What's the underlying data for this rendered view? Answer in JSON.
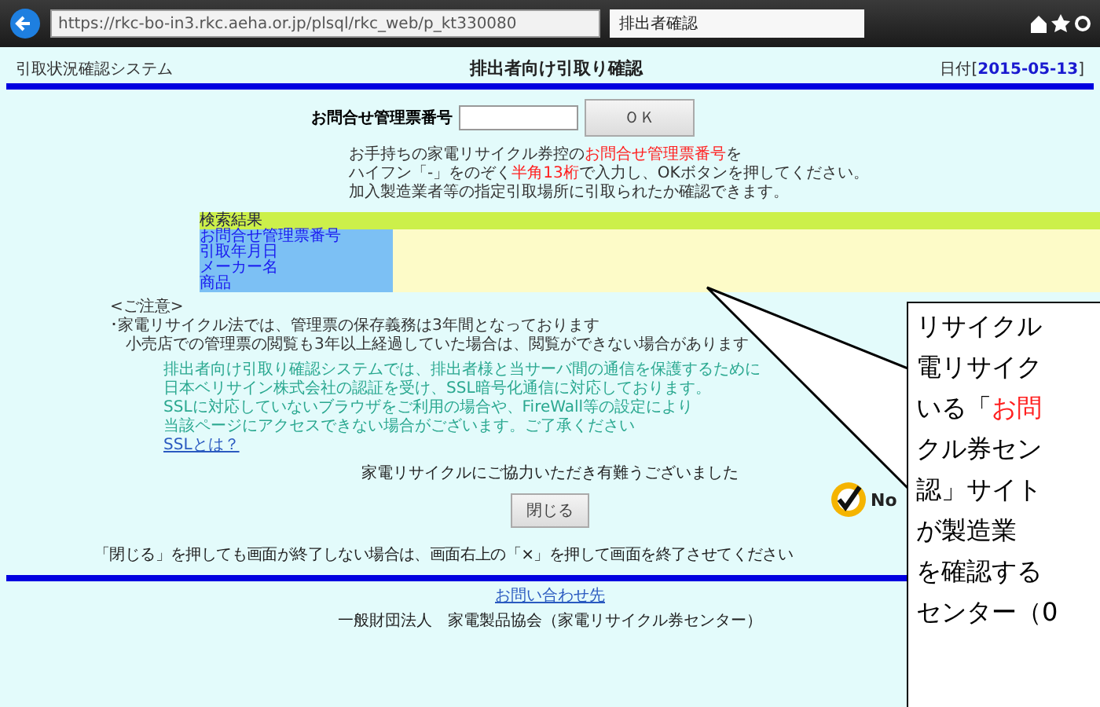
{
  "browser": {
    "url": "https://rkc-bo-in3.rkc.aeha.or.jp/plsql/rkc_web/p_kt330080",
    "tab_title": "排出者確認"
  },
  "header": {
    "system_name": "引取状況確認システム",
    "title": "排出者向け引取り確認",
    "date_label": "日付[",
    "date": "2015-05-13",
    "date_close": "]"
  },
  "form": {
    "label": "お問合せ管理票番号",
    "button": "ＯＫ"
  },
  "instructions": [
    [
      {
        "text": "お手持ちの家電リサイクル券控の",
        "highlight": false
      },
      {
        "text": "お問合せ管理票番号",
        "highlight": true
      },
      {
        "text": "を",
        "highlight": false
      }
    ],
    [
      {
        "text": "ハイフン「-」をのぞく",
        "highlight": false
      },
      {
        "text": "半角13桁",
        "highlight": true
      },
      {
        "text": "で入力し、OKボタンを押してください。",
        "highlight": false
      }
    ],
    [
      {
        "text": "加入製造業者等の指定引取場所に引取られたか確認できます。",
        "highlight": false
      }
    ]
  ],
  "results": {
    "heading": "検索結果",
    "fields": [
      "お問合せ管理票番号",
      "引取年月日",
      "メーカー名",
      "商品"
    ]
  },
  "notice": {
    "heading": "<ご注意>",
    "lines": [
      "･家電リサイクル法では、管理票の保存義務は3年間となっております",
      "　小売店での管理票の閲覧も3年以上経過していた場合は、閲覧ができない場合があります"
    ]
  },
  "ssl": {
    "lines": [
      "排出者向け引取り確認システムでは、排出者様と当サーバ間の通信を保護するために",
      "日本ベリサイン株式会社の認証を受け、SSL暗号化通信に対応しております。",
      "SSLに対応していないブラウザをご利用の場合や、FireWall等の設定により",
      "当該ページにアクセスできない場合がございます。ご了承ください"
    ],
    "link": "SSLとは？"
  },
  "thanks": "家電リサイクルにご協力いただき有難うございました",
  "close_button": "閉じる",
  "seal_text": "No",
  "close_note": "「閉じる」を押しても画面が終了しない場合は、画面右上の「×」を押して画面を終了させてください",
  "footer": {
    "contact_link": "お問い合わせ先",
    "organization": "一般財団法人　家電製品協会（家電リサイクル券センター）"
  },
  "callout": {
    "lines": [
      [
        {
          "text": "リサイクル",
          "highlight": false
        }
      ],
      [
        {
          "text": "電リサイク",
          "highlight": false
        }
      ],
      [
        {
          "text": "いる「",
          "highlight": false
        },
        {
          "text": "お問",
          "highlight": true
        }
      ],
      [
        {
          "text": "クル券セン",
          "highlight": false
        }
      ],
      [
        {
          "text": "認」サイト",
          "highlight": false
        }
      ],
      [
        {
          "text": "が製造業",
          "highlight": false
        }
      ],
      [
        {
          "text": "を確認する",
          "highlight": false
        }
      ],
      [
        {
          "text": "センター（0",
          "highlight": false
        }
      ]
    ]
  }
}
